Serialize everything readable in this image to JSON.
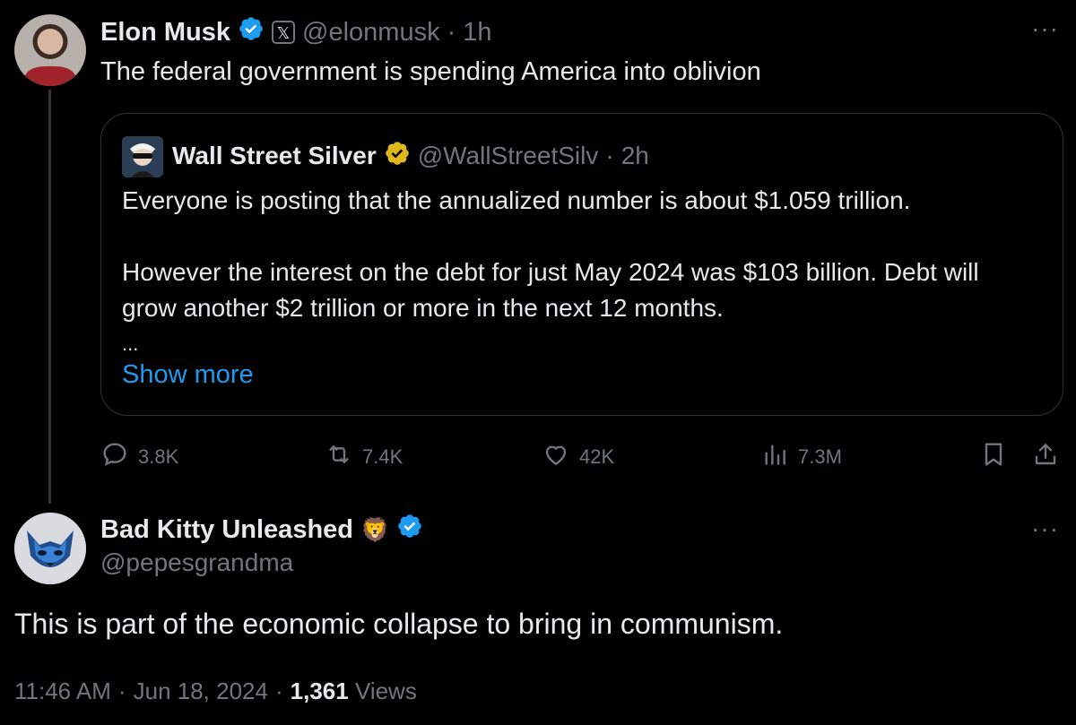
{
  "main_tweet": {
    "author_name": "Elon Musk",
    "handle": "@elonmusk",
    "separator": "·",
    "time": "1h",
    "text": "The federal government is spending America into oblivion",
    "more_glyph": "···"
  },
  "quoted_tweet": {
    "author_name": "Wall Street Silver",
    "handle": "@WallStreetSilv",
    "separator": "·",
    "time": "2h",
    "lines": [
      "Everyone is posting that the annualized number is about $1.059 trillion.",
      "However the interest on the debt for just May 2024 was $103 billion. Debt will",
      "grow another $2 trillion or more in the next 12 months.",
      "..."
    ],
    "show_more_label": "Show more"
  },
  "actions": {
    "replies": "3.8K",
    "reposts": "7.4K",
    "likes": "42K",
    "views": "7.3M"
  },
  "reply_tweet": {
    "author_name": "Bad Kitty Unleashed",
    "author_emoji": "🦁",
    "handle": "@pepesgrandma",
    "text": "This is part of the economic collapse to bring in communism.",
    "more_glyph": "···",
    "time": "11:46 AM",
    "date": "Jun 18, 2024",
    "separator": "·",
    "views_count": "1,361",
    "views_label": "Views"
  },
  "colors": {
    "background": "#000000",
    "text": "#e7e9ea",
    "muted": "#71767b",
    "link": "#1d9bf0",
    "verified_blue": "#1d9bf0",
    "verified_gold": "#e2b719",
    "border": "#2f3336"
  },
  "icons": {
    "reply": "reply-icon",
    "repost": "repost-icon",
    "like": "heart-icon",
    "views": "views-icon",
    "bookmark": "bookmark-icon",
    "share": "share-icon",
    "verified": "verified-badge-icon",
    "affiliate": "x-affiliate-icon"
  }
}
